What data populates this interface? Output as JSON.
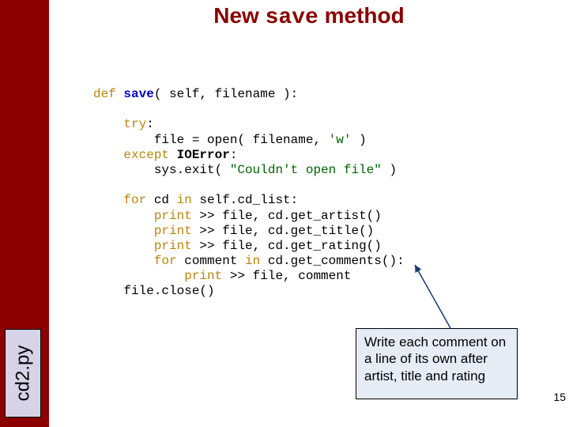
{
  "sidebar": {
    "label": "cd2.py"
  },
  "title": {
    "pre": "New ",
    "mono": "save",
    "post": " method"
  },
  "code": {
    "line1_def": "def",
    "line1_name": "save",
    "line1_rest": "( self, filename ):",
    "try_kw": "try",
    "open_line_a": "file = open( filename, ",
    "open_line_str": "'w'",
    "open_line_b": " )",
    "except_kw": "except",
    "except_err": "IOError",
    "sysexit_a": "sys.exit( ",
    "sysexit_str": "\"Couldn't open file\"",
    "sysexit_b": " )",
    "for_kw": "for",
    "for_line": " cd ",
    "in_kw": "in",
    "for_rest": " self.cd_list:",
    "print_kw": "print",
    "print1": " >> file, cd.get_artist()",
    "print2": " >> file, cd.get_title()",
    "print3": " >> file, cd.get_rating()",
    "for2_rest": " comment ",
    "for2_rest2": " cd.get_comments():",
    "print4": " >> file, comment",
    "close": "file.close()"
  },
  "annotation": {
    "text": "Write each comment on a line of its own after artist, title and rating"
  },
  "page": {
    "number": "15"
  }
}
